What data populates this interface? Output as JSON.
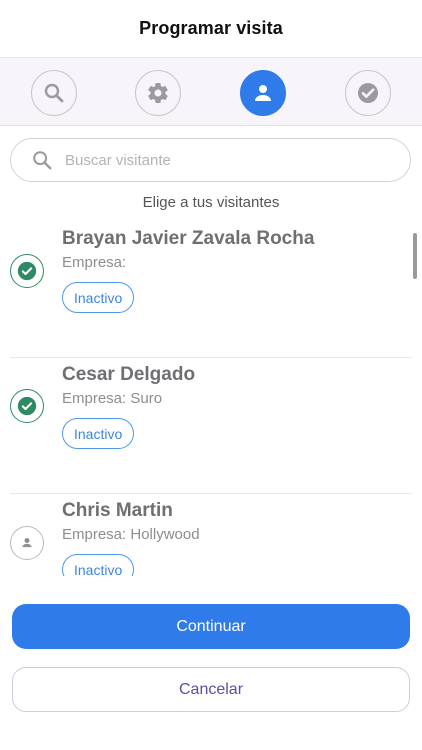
{
  "header": {
    "title": "Programar visita"
  },
  "stepper": {
    "active_index": 2,
    "active_color": "#2f7bea",
    "steps": [
      {
        "icon": "search-icon"
      },
      {
        "icon": "gear-icon"
      },
      {
        "icon": "person-icon"
      },
      {
        "icon": "check-circle-icon"
      }
    ]
  },
  "search": {
    "placeholder": "Buscar visitante",
    "value": ""
  },
  "subtitle": "Elige a tus visitantes",
  "visitors": [
    {
      "name": "Brayan Javier Zavala Rocha",
      "company": "Empresa:",
      "status": "Inactivo",
      "selected": true
    },
    {
      "name": "Cesar Delgado",
      "company": "Empresa: Suro",
      "status": "Inactivo",
      "selected": true
    },
    {
      "name": "Chris Martin",
      "company": "Empresa: Hollywood",
      "status": "Inactivo",
      "selected": false
    }
  ],
  "actions": {
    "continue_label": "Continuar",
    "cancel_label": "Cancelar"
  },
  "colors": {
    "primary": "#2f7bea",
    "selected_check": "#2e8a63",
    "badge": "#3c86dc",
    "cancel_text": "#5a4ea8"
  }
}
